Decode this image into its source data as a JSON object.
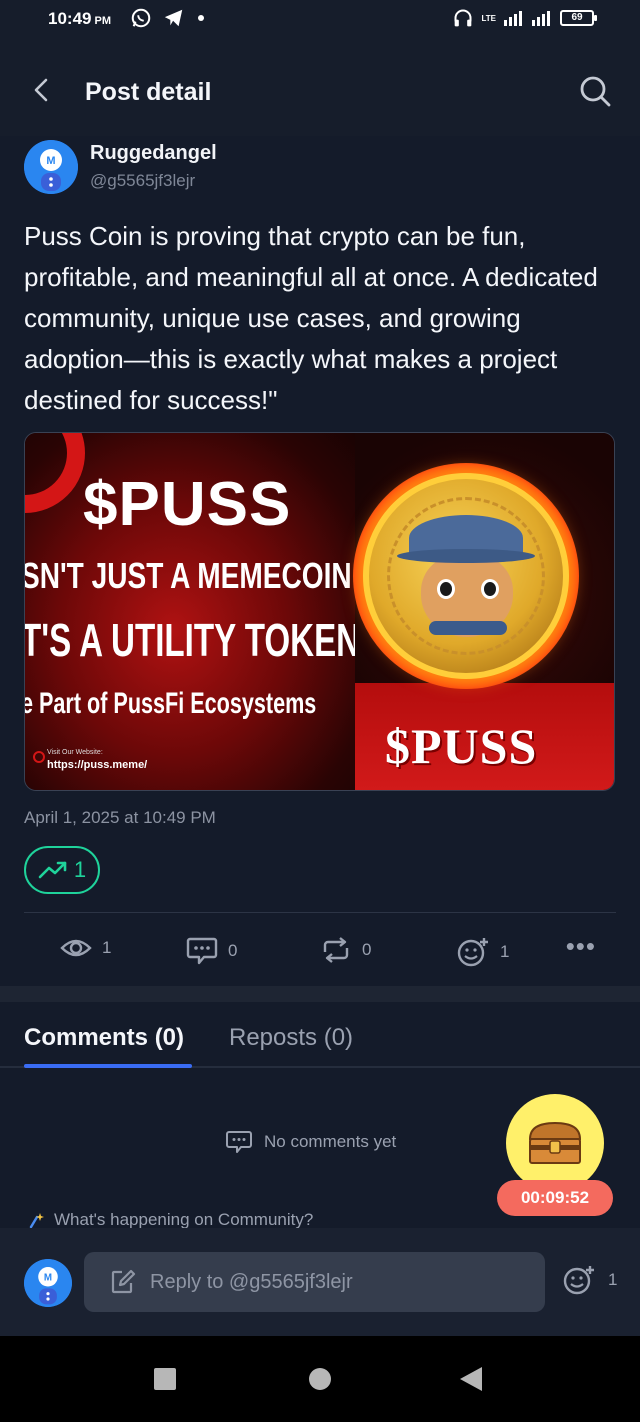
{
  "status_bar": {
    "time": "10:49",
    "ampm": "PM",
    "network_label": "LTE",
    "battery": "69"
  },
  "header": {
    "title": "Post detail"
  },
  "post": {
    "author_name": "Ruggedangel",
    "author_handle": "@g5565jf3lejr",
    "text": "Puss Coin is proving that crypto can be fun, profitable, and meaningful all at once. A dedicated community, unique use cases, and growing adoption—this is exactly what makes a project destined for success!\"",
    "image": {
      "ticker": "$PUSS",
      "line1": "SN'T JUST A MEMECOIN",
      "line2": "T'S A UTILITY TOKEN",
      "line3": "e Part of PussFi Ecosystems",
      "visit_label": "Visit Our Website:",
      "url": "https://puss.meme/",
      "coin_ticker": "$PUSS"
    },
    "date": "April 1, 2025 at 10:49 PM",
    "trend_count": "1",
    "stats": {
      "views": "1",
      "comments": "0",
      "reposts": "0",
      "reactions": "1"
    }
  },
  "tabs": {
    "comments": "Comments (0)",
    "reposts": "Reposts (0)"
  },
  "comments": {
    "empty_text": "No comments yet",
    "whats_happening": "What's happening on Community?"
  },
  "reward": {
    "timer": "00:09:52"
  },
  "reply": {
    "placeholder": "Reply to @g5565jf3lejr",
    "reaction_count": "1"
  },
  "colors": {
    "background": "#141b2a",
    "accent_blue": "#3a6cf4",
    "trend_green": "#1fd39b",
    "timer_red": "#f46a5e",
    "chest_yellow": "#fff06a"
  }
}
